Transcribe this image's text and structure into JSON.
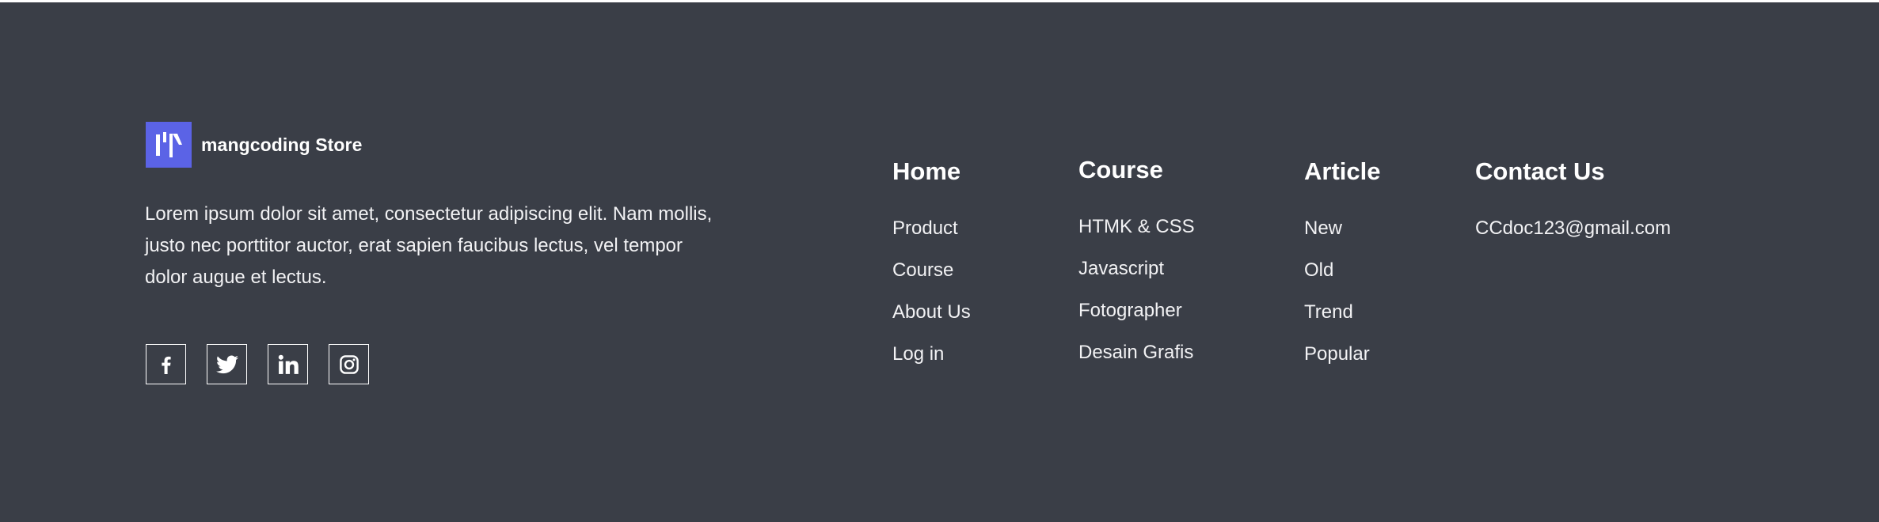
{
  "brand": {
    "name": "mangcoding Store",
    "logo_color": "#5b63e6"
  },
  "description": "Lorem ipsum dolor sit amet, consectetur adipiscing elit. Nam mollis, justo nec porttitor auctor, erat sapien faucibus lectus, vel tempor dolor augue et lectus.",
  "socials": [
    {
      "icon": "facebook-icon"
    },
    {
      "icon": "twitter-icon"
    },
    {
      "icon": "linkedin-icon"
    },
    {
      "icon": "instagram-icon"
    }
  ],
  "columns": {
    "home": {
      "title": "Home",
      "links": [
        "Product",
        "Course",
        "About Us",
        "Log in"
      ]
    },
    "course": {
      "title": "Course",
      "links": [
        "HTMK & CSS",
        "Javascript",
        "Fotographer",
        "Desain Grafis"
      ]
    },
    "article": {
      "title": "Article",
      "links": [
        "New",
        "Old",
        "Trend",
        "Popular"
      ]
    },
    "contact": {
      "title": "Contact Us",
      "email": "CCdoc123@gmail.com"
    }
  },
  "colors": {
    "background": "#3a3e47",
    "text": "#ffffff",
    "accent": "#5b63e6"
  }
}
